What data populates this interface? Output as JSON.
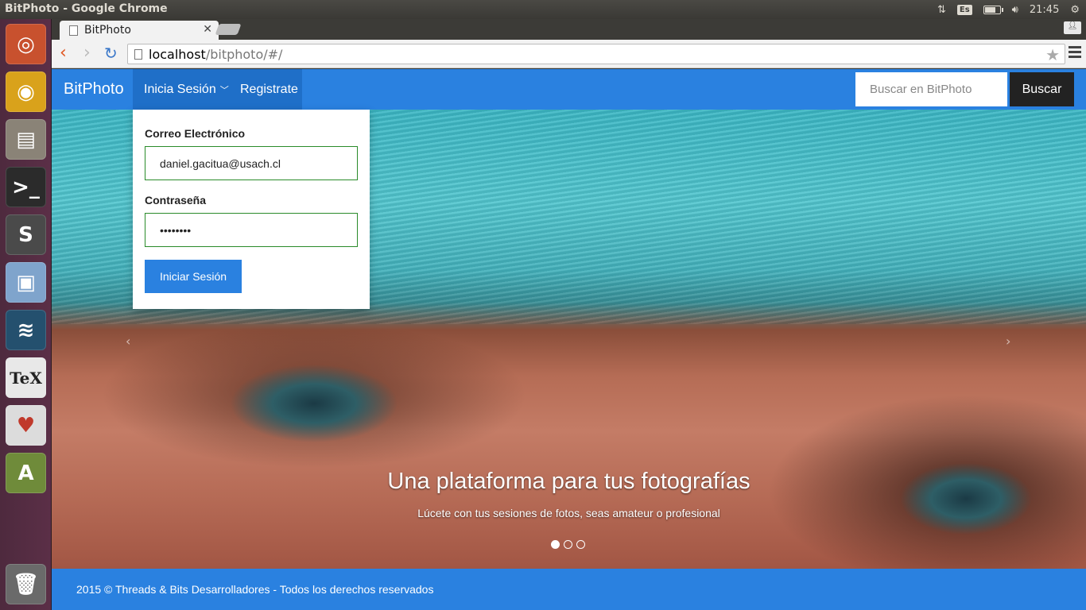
{
  "os": {
    "window_title": "BitPhoto - Google Chrome",
    "keyboard_layout": "Es",
    "clock": "21:45",
    "battery_level": 0.8
  },
  "launcher": [
    {
      "name": "ubuntu-dash-icon",
      "glyph": "◎",
      "color": "#c8512e"
    },
    {
      "name": "chrome-icon",
      "glyph": "◉",
      "color": "#d9a21b"
    },
    {
      "name": "files-icon",
      "glyph": "▤",
      "color": "#8a8377"
    },
    {
      "name": "terminal-icon",
      "glyph": ">_",
      "color": "#2b2b2b"
    },
    {
      "name": "sublime-text-icon",
      "glyph": "S",
      "color": "#4a4a4a"
    },
    {
      "name": "virtualbox-icon",
      "glyph": "▣",
      "color": "#7fa4cc"
    },
    {
      "name": "mysql-workbench-icon",
      "glyph": "≋",
      "color": "#24506e"
    },
    {
      "name": "texmaker-icon",
      "glyph": "TeX",
      "color": "#e8e8e8"
    },
    {
      "name": "solitaire-icon",
      "glyph": "♥",
      "color": "#dcdcdc"
    },
    {
      "name": "software-updater-icon",
      "glyph": "A",
      "color": "#6f8b3a"
    },
    {
      "name": "trash-icon",
      "glyph": "🗑",
      "color": "#6a6a6a"
    }
  ],
  "browser": {
    "tab_title": "BitPhoto",
    "url_host": "localhost",
    "url_path": "/bitphoto/#/"
  },
  "navbar": {
    "brand": "BitPhoto",
    "login_menu": "Inicia Sesión",
    "register": "Registrate",
    "search_placeholder": "Buscar en BitPhoto",
    "search_button": "Buscar"
  },
  "login_form": {
    "email_label": "Correo Electrónico",
    "email_value": "daniel.gacitua@usach.cl",
    "password_label": "Contraseña",
    "password_value": "••••••••",
    "submit": "Iniciar Sesión"
  },
  "carousel": {
    "caption_title": "Una plataforma para tus fotografías",
    "caption_subtitle": "Lúcete con tus sesiones de fotos, seas amateur o profesional",
    "prev": "‹",
    "next": "›"
  },
  "footer": {
    "text": "2015 © Threads & Bits Desarrolladores - Todos los derechos reservados"
  }
}
